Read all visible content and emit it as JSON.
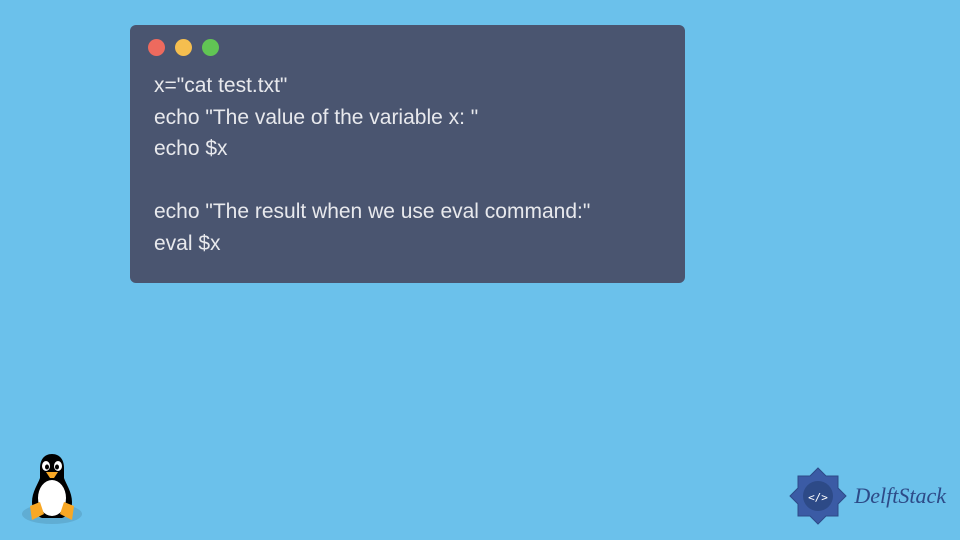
{
  "code": {
    "line1": "x=\"cat test.txt\"",
    "line2": "echo \"The value of the variable x: \"",
    "line3": "echo $x",
    "line4": "",
    "line5": "echo \"The result when we use eval command:\"",
    "line6": "eval $x"
  },
  "branding": {
    "name": "DelftStack"
  }
}
